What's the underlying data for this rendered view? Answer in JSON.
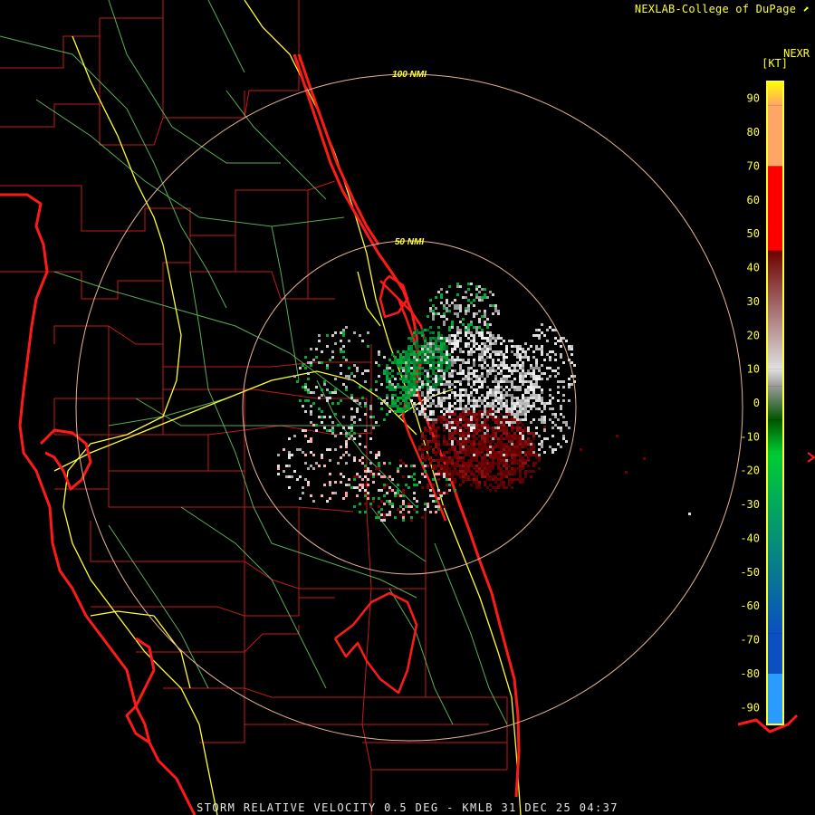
{
  "header": {
    "credit": "NEXLAB-College of DuPage"
  },
  "legend": {
    "product": "NEXR",
    "unit": "[KT]",
    "ticks": [
      "90",
      "80",
      "70",
      "60",
      "50",
      "40",
      "30",
      "20",
      "10",
      "0",
      "-10",
      "-20",
      "-30",
      "-40",
      "-50",
      "-60",
      "-70",
      "-80",
      "-90"
    ],
    "colors": {
      "tick_text": "#ffff33",
      "top": "#ffff00",
      "light_orange": "#ffa566",
      "red": "#ff0000",
      "dark_red": "#6e0000",
      "gray_light": "#e0e0e0",
      "gray_mid": "#9a9a9a",
      "dark_green": "#005500",
      "green": "#00cc33",
      "blue": "#0b4fc0",
      "light_blue": "#2a9cff"
    }
  },
  "range_rings": {
    "labels": [
      "100 NMI",
      "50 NMI"
    ],
    "color": "#e8b49a",
    "label_color": "#ffff33"
  },
  "map_colors": {
    "county_lines": "#c41a1a",
    "coastline": "#ff1a1a",
    "highways": "#ffff33",
    "roads": "#66cc66"
  },
  "footer": {
    "text": "STORM RELATIVE VELOCITY 0.5 DEG - KMLB 31 DEC 25 04:37"
  }
}
